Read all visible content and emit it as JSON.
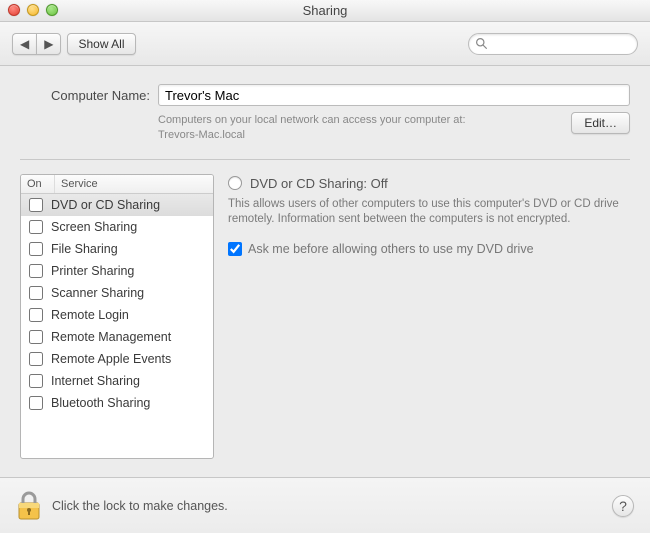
{
  "window": {
    "title": "Sharing"
  },
  "toolbar": {
    "show_all": "Show All",
    "search_placeholder": ""
  },
  "computer_name": {
    "label": "Computer Name:",
    "value": "Trevor's Mac",
    "subtext_line1": "Computers on your local network can access your computer at:",
    "subtext_line2": "Trevors-Mac.local",
    "edit_label": "Edit…"
  },
  "services": {
    "col_on": "On",
    "col_service": "Service",
    "items": [
      {
        "label": "DVD or CD Sharing",
        "on": false,
        "selected": true
      },
      {
        "label": "Screen Sharing",
        "on": false,
        "selected": false
      },
      {
        "label": "File Sharing",
        "on": false,
        "selected": false
      },
      {
        "label": "Printer Sharing",
        "on": false,
        "selected": false
      },
      {
        "label": "Scanner Sharing",
        "on": false,
        "selected": false
      },
      {
        "label": "Remote Login",
        "on": false,
        "selected": false
      },
      {
        "label": "Remote Management",
        "on": false,
        "selected": false
      },
      {
        "label": "Remote Apple Events",
        "on": false,
        "selected": false
      },
      {
        "label": "Internet Sharing",
        "on": false,
        "selected": false
      },
      {
        "label": "Bluetooth Sharing",
        "on": false,
        "selected": false
      }
    ]
  },
  "detail": {
    "title": "DVD or CD Sharing: Off",
    "description": "This allows users of other computers to use this computer's DVD or CD drive remotely. Information sent between the computers is not encrypted.",
    "ask_option_label": "Ask me before allowing others to use my DVD drive",
    "ask_option_checked": true
  },
  "footer": {
    "lock_text": "Click the lock to make changes."
  }
}
